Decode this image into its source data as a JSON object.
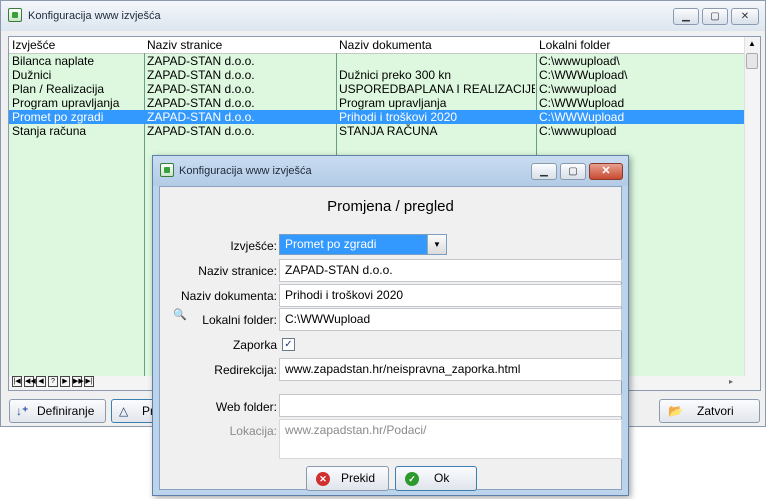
{
  "main": {
    "title": "Konfiguracija www izvješća",
    "columns": [
      "Izvješće",
      "Naziv stranice",
      "Naziv dokumenta",
      "Lokalni folder"
    ],
    "rows": [
      [
        "Bilanca naplate",
        "ZAPAD-STAN d.o.o.",
        "",
        "C:\\wwwupload\\"
      ],
      [
        "Dužnici",
        "ZAPAD-STAN d.o.o.",
        "Dužnici preko 300 kn",
        "C:\\WWWupload\\"
      ],
      [
        "Plan / Realizacija",
        "ZAPAD-STAN d.o.o.",
        "USPOREDBAPLANA I REALIZACIJE",
        "C:\\wwwupload"
      ],
      [
        "Program upravljanja",
        "ZAPAD-STAN d.o.o.",
        "Program upravljanja",
        "C:\\WWWupload"
      ],
      [
        "Promet po zgradi",
        "ZAPAD-STAN d.o.o.",
        "Prihodi i troškovi 2020",
        "C:\\WWWupload"
      ],
      [
        "Stanja računa",
        "ZAPAD-STAN d.o.o.",
        "STANJA RAČUNA",
        "C:\\wwwupload"
      ]
    ],
    "selected_row": 4,
    "buttons": {
      "define": "Definiranje",
      "change": "Pr",
      "close": "Zatvori"
    },
    "navigator": [
      "|◀",
      "◀◀",
      "◀",
      "?",
      "▶",
      "▶▶",
      "▶|"
    ]
  },
  "dialog": {
    "title": "Konfiguracija www izvješća",
    "heading": "Promjena / pregled",
    "labels": {
      "report": "Izvješće:",
      "page_name": "Naziv stranice:",
      "doc_name": "Naziv dokumenta:",
      "local_folder": "Lokalni folder:",
      "password": "Zaporka",
      "redirect": "Redirekcija:",
      "web_folder": "Web folder:",
      "location": "Lokacija:"
    },
    "values": {
      "report": "Promet po zgradi",
      "page_name": "ZAPAD-STAN d.o.o.",
      "doc_name": "Prihodi i troškovi 2020",
      "local_folder": "C:\\WWWupload",
      "password_checked": true,
      "redirect": "www.zapadstan.hr/neispravna_zaporka.html",
      "web_folder": "",
      "location": "www.zapadstan.hr/Podaci/"
    },
    "buttons": {
      "cancel": "Prekid",
      "ok": "Ok"
    }
  },
  "colors": {
    "grid_bg": "#ddf8df",
    "selection": "#3399ff",
    "dialog_frame": "#bcd3ec"
  }
}
